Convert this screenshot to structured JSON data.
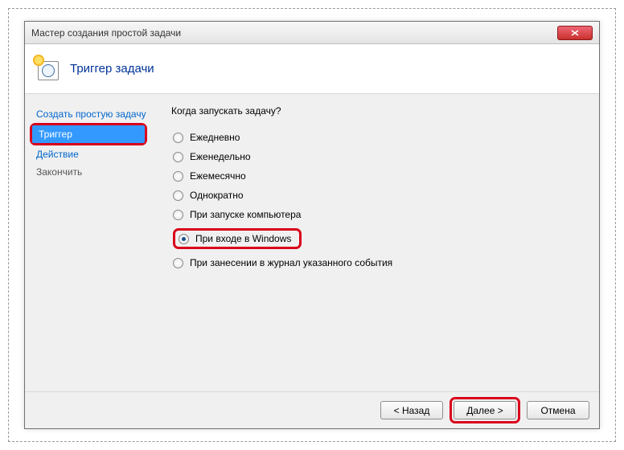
{
  "window": {
    "title": "Мастер создания простой задачи"
  },
  "header": {
    "title": "Триггер задачи"
  },
  "sidebar": {
    "items": [
      {
        "label": "Создать простую задачу",
        "selected": false
      },
      {
        "label": "Триггер",
        "selected": true
      },
      {
        "label": "Действие",
        "selected": false
      },
      {
        "label": "Закончить",
        "selected": false
      }
    ]
  },
  "content": {
    "question": "Когда запускать задачу?",
    "options": [
      {
        "label": "Ежедневно",
        "checked": false
      },
      {
        "label": "Еженедельно",
        "checked": false
      },
      {
        "label": "Ежемесячно",
        "checked": false
      },
      {
        "label": "Однократно",
        "checked": false
      },
      {
        "label": "При запуске компьютера",
        "checked": false
      },
      {
        "label": "При входе в Windows",
        "checked": true
      },
      {
        "label": "При занесении в журнал указанного события",
        "checked": false
      }
    ]
  },
  "footer": {
    "back": "< Назад",
    "next": "Далее >",
    "cancel": "Отмена"
  }
}
